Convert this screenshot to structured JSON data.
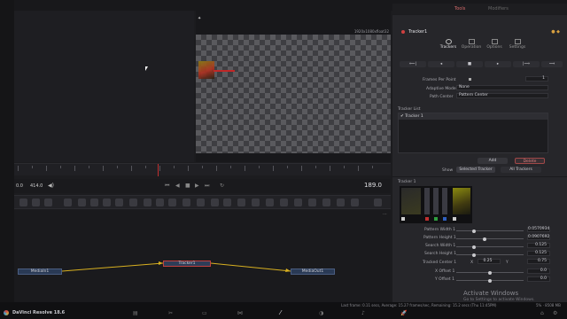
{
  "inspector": {
    "tabs": [
      "Tools",
      "Modifiers"
    ],
    "node_name": "Tracker1",
    "subtabs": [
      "Trackers",
      "Operation",
      "Options",
      "Settings"
    ],
    "frames_per_point_label": "Frames Per Point",
    "frames_per_point_value": "1",
    "adaptive_mode_label": "Adaptive Mode",
    "adaptive_mode_value": "None",
    "path_center_label": "Path Center",
    "path_center_value": "Pattern Center",
    "tracker_list_label": "Tracker List",
    "tracker_item": "Tracker 1",
    "add_label": "Add",
    "delete_label": "Delete",
    "show_label": "Show",
    "selected_tracker_label": "Selected Tracker",
    "all_trackers_label": "All Trackers",
    "tracker_section": "Tracker 1",
    "params": [
      {
        "label": "Pattern Width 1",
        "value": "0.0570934"
      },
      {
        "label": "Pattern Height 1",
        "value": "0.0907692"
      },
      {
        "label": "Search Width 1",
        "value": "0.125"
      },
      {
        "label": "Search Height 1",
        "value": "0.125"
      }
    ],
    "tracked_center_label": "Tracked Center 1",
    "tracked_center_x_label": "X",
    "tracked_center_x": "0.25",
    "tracked_center_y_label": "Y",
    "tracked_center_y": "0.75",
    "x_offset_label": "X Offset 1",
    "x_offset_value": "0.0",
    "y_offset_label": "Y Offset 1",
    "y_offset_value": "0.0"
  },
  "viewer": {
    "resolution": "1920x1080xfloat32"
  },
  "timeline": {
    "start_frame": "0.0",
    "end_frame": "414.0",
    "current_frame": "189.0"
  },
  "nodes": {
    "media_in": "MediaIn1",
    "tracker": "Tracker1",
    "media_out": "MediaOut1"
  },
  "status": {
    "app_name": "DaVinci Resolve 18.6",
    "render_info": "Last frame: 0.11 secs, Average: 15.27 frames/sec, Remaining: 15.2 secs (Thu 11:45PM)",
    "memory": "5% · 8508 MB"
  },
  "watermark": {
    "title": "Activate Windows",
    "subtitle": "Go to Settings to activate Windows."
  }
}
